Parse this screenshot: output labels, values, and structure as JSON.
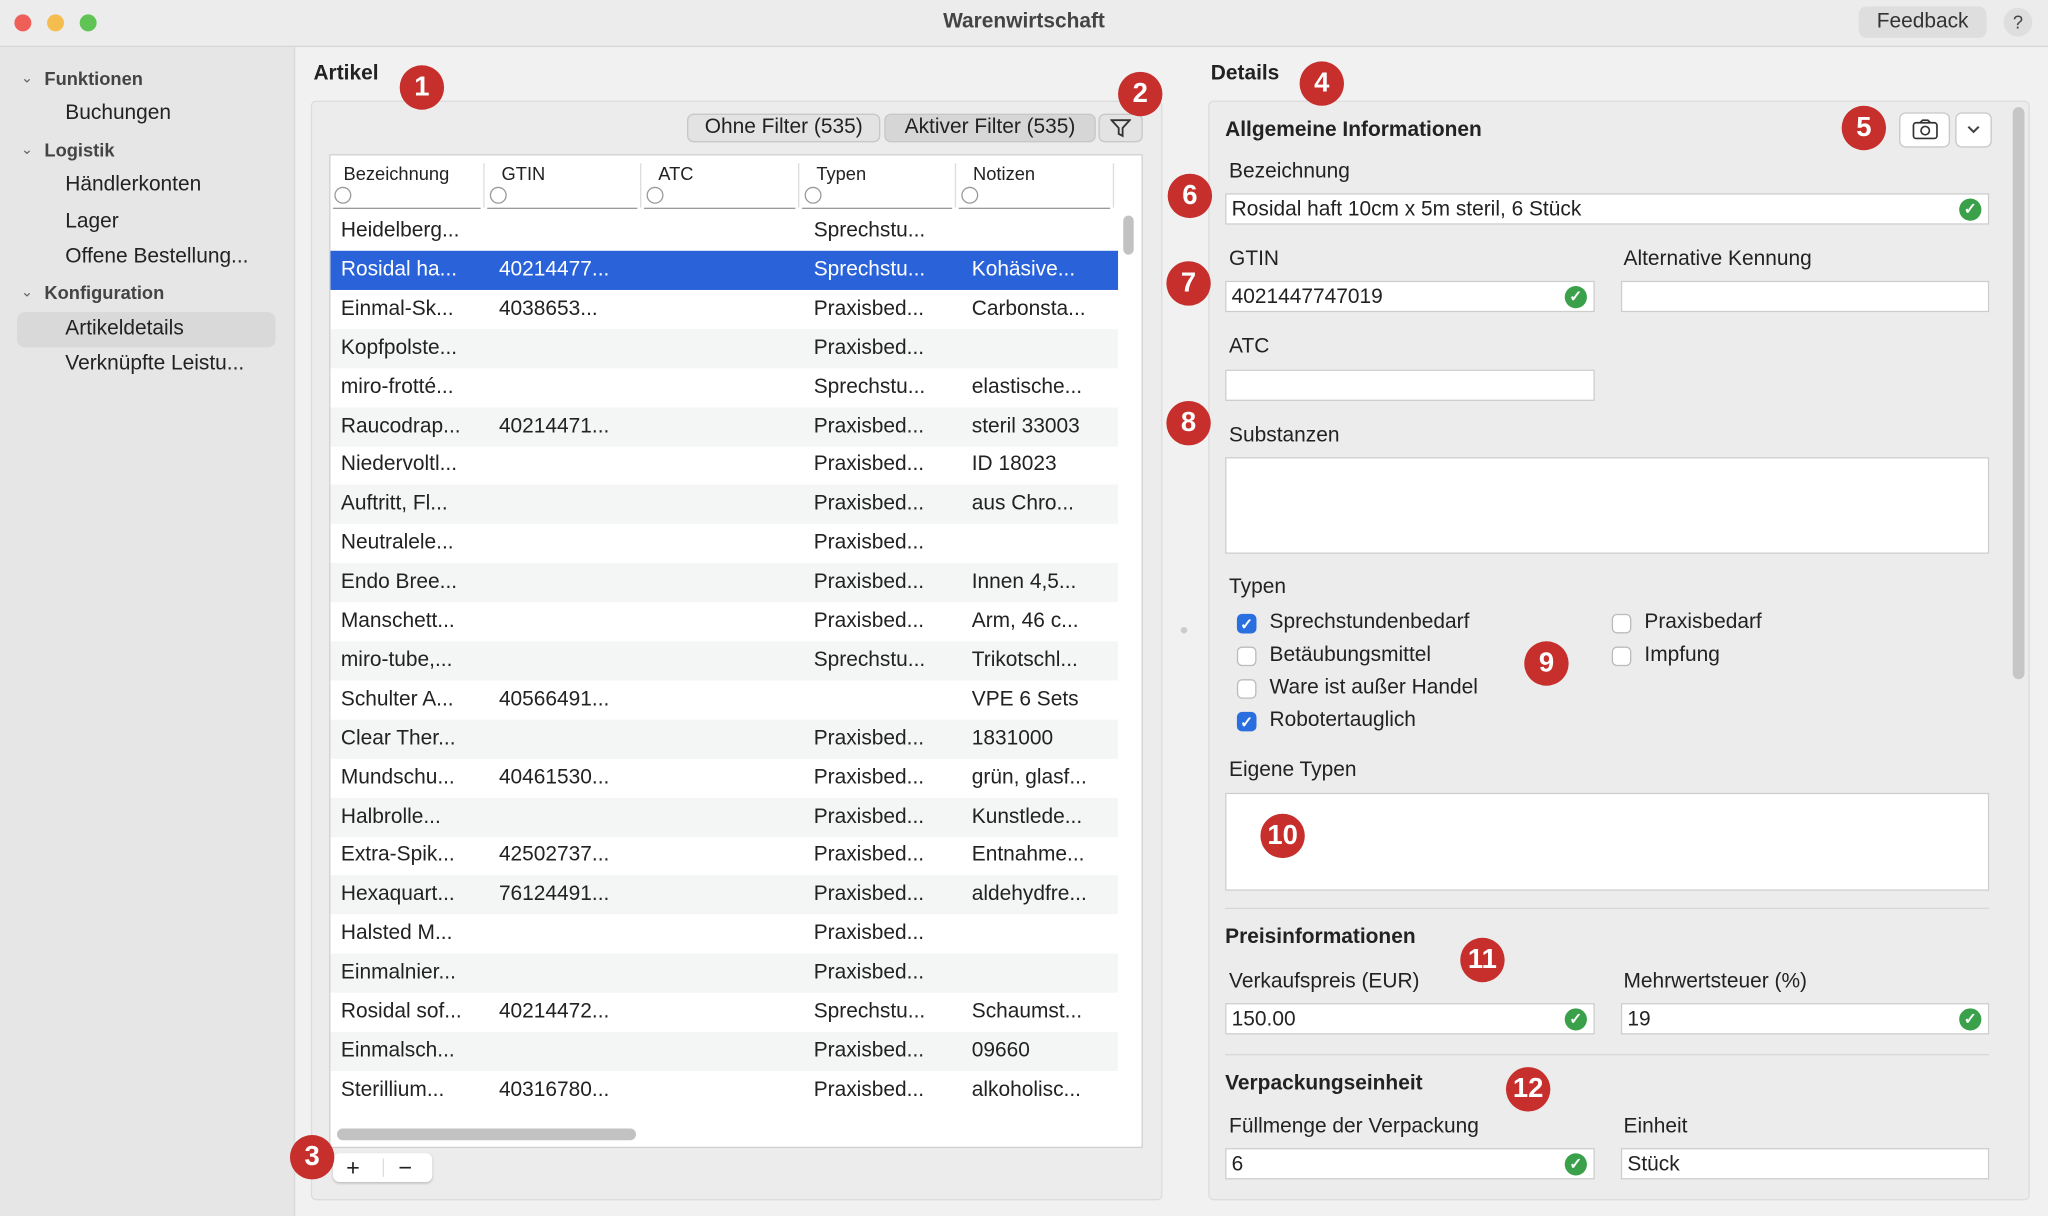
{
  "window": {
    "title": "Warenwirtschaft",
    "feedback_label": "Feedback",
    "help_label": "?"
  },
  "sidebar": {
    "groups": [
      {
        "label": "Funktionen",
        "items": [
          "Buchungen"
        ]
      },
      {
        "label": "Logistik",
        "items": [
          "Händlerkonten",
          "Lager",
          "Offene Bestellung..."
        ]
      },
      {
        "label": "Konfiguration",
        "items": [
          "Artikeldetails",
          "Verknüpfte Leistu..."
        ]
      }
    ],
    "selected": "Artikeldetails"
  },
  "articles": {
    "title": "Artikel",
    "filter_none_label": "Ohne Filter (535)",
    "filter_active_label": "Aktiver Filter (535)",
    "columns": [
      "Bezeichnung",
      "GTIN",
      "ATC",
      "Typen",
      "Notizen"
    ],
    "rows": [
      [
        "Heidelberg...",
        "",
        "",
        "Sprechstu...",
        ""
      ],
      [
        "Rosidal ha...",
        "40214477...",
        "",
        "Sprechstu...",
        "Kohäsive..."
      ],
      [
        "Einmal-Sk...",
        "4038653...",
        "",
        "Praxisbed...",
        "Carbonsta..."
      ],
      [
        "Kopfpolste...",
        "",
        "",
        "Praxisbed...",
        ""
      ],
      [
        "miro-frotté...",
        "",
        "",
        "Sprechstu...",
        "elastische..."
      ],
      [
        "Raucodrap...",
        "40214471...",
        "",
        "Praxisbed...",
        "steril 33003"
      ],
      [
        "Niedervoltl...",
        "",
        "",
        "Praxisbed...",
        "ID 18023"
      ],
      [
        "Auftritt, Fl...",
        "",
        "",
        "Praxisbed...",
        "aus Chro..."
      ],
      [
        "Neutralele...",
        "",
        "",
        "Praxisbed...",
        ""
      ],
      [
        "Endo Bree...",
        "",
        "",
        "Praxisbed...",
        "Innen 4,5..."
      ],
      [
        "Manschett...",
        "",
        "",
        "Praxisbed...",
        "Arm, 46 c..."
      ],
      [
        "miro-tube,...",
        "",
        "",
        "Sprechstu...",
        "Trikotschl..."
      ],
      [
        "Schulter A...",
        "40566491...",
        "",
        "",
        "VPE 6 Sets"
      ],
      [
        "Clear Ther...",
        "",
        "",
        "Praxisbed...",
        "1831000"
      ],
      [
        "Mundschu...",
        "40461530...",
        "",
        "Praxisbed...",
        "grün, glasf..."
      ],
      [
        "Halbrolle...",
        "",
        "",
        "Praxisbed...",
        "Kunstlede..."
      ],
      [
        "Extra-Spik...",
        "42502737...",
        "",
        "Praxisbed...",
        "Entnahme..."
      ],
      [
        "Hexaquart...",
        "76124491...",
        "",
        "Praxisbed...",
        "aldehydfre..."
      ],
      [
        "Halsted M...",
        "",
        "",
        "Praxisbed...",
        ""
      ],
      [
        "Einmalnier...",
        "",
        "",
        "Praxisbed...",
        ""
      ],
      [
        "Rosidal sof...",
        "40214472...",
        "",
        "Sprechstu...",
        "Schaumst..."
      ],
      [
        "Einmalsch...",
        "",
        "",
        "Praxisbed...",
        "09660"
      ],
      [
        "Sterillium...",
        "40316780...",
        "",
        "Praxisbed...",
        "alkoholisc..."
      ]
    ],
    "selected_row": 1,
    "add_label": "+",
    "remove_label": "−"
  },
  "details": {
    "title": "Details",
    "general_title": "Allgemeine Informationen",
    "bezeichnung_label": "Bezeichnung",
    "bezeichnung_value": "Rosidal haft 10cm x 5m steril,  6 Stück",
    "gtin_label": "GTIN",
    "gtin_value": "4021447747019",
    "alt_label": "Alternative Kennung",
    "alt_value": "",
    "atc_label": "ATC",
    "atc_value": "",
    "substanzen_label": "Substanzen",
    "typen_label": "Typen",
    "typen": [
      {
        "label": "Sprechstundenbedarf",
        "checked": true
      },
      {
        "label": "Betäubungsmittel",
        "checked": false
      },
      {
        "label": "Ware ist außer Handel",
        "checked": false
      },
      {
        "label": "Robotertauglich",
        "checked": true
      },
      {
        "label": "Praxisbedarf",
        "checked": false
      },
      {
        "label": "Impfung",
        "checked": false
      }
    ],
    "eigene_typen_label": "Eigene Typen",
    "price_title": "Preisinformationen",
    "vk_label": "Verkaufspreis (EUR)",
    "vk_value": "150.00",
    "mwst_label": "Mehrwertsteuer (%)",
    "mwst_value": "19",
    "pack_title": "Verpackungseinheit",
    "fill_label": "Füllmenge der Verpackung",
    "fill_value": "6",
    "unit_label": "Einheit",
    "unit_value": "Stück"
  },
  "badges": [
    "1",
    "2",
    "3",
    "4",
    "5",
    "6",
    "7",
    "8",
    "9",
    "10",
    "11",
    "12"
  ],
  "colors": {
    "selection": "#2a62d9",
    "badge": "#c62f2b",
    "valid": "#3aa14a",
    "checkbox": "#2a6fe0"
  }
}
